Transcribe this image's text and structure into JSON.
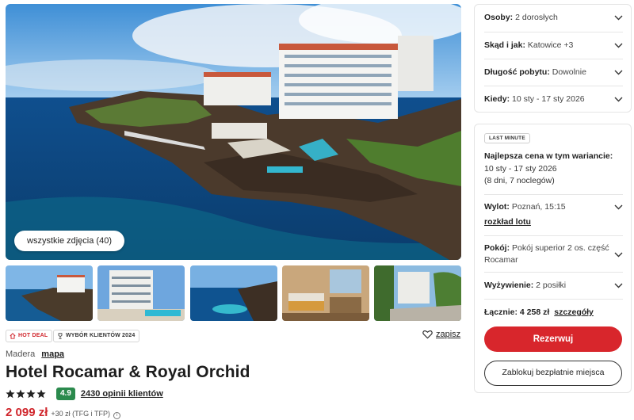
{
  "gallery": {
    "all_photos_label": "wszystkie zdjęcia (40)"
  },
  "badges": {
    "hot_deal": "HOT DEAL",
    "award": "WYBÓR KLIENTÓW 2024"
  },
  "save_label": "zapisz",
  "hotel": {
    "region": "Madera",
    "map_link": "mapa",
    "name": "Hotel Rocamar & Royal Orchid",
    "stars": 4,
    "score": "4.9",
    "reviews": "2430 opinii klientów",
    "price": "2 099 zł",
    "price_extra": "+30 zł (TFG i TFP)"
  },
  "search": {
    "persons_label": "Osoby:",
    "persons_value": "2 dorosłych",
    "from_label": "Skąd i jak:",
    "from_value": "Katowice +3",
    "length_label": "Długość pobytu:",
    "length_value": "Dowolnie",
    "when_label": "Kiedy:",
    "when_value": "10 sty - 17 sty 2026"
  },
  "offer": {
    "badge": "LAST MINUTE",
    "best_title": "Najlepsza cena w tym wariancie:",
    "best_dates": "10 sty - 17 sty 2026",
    "best_nights": "(8 dni, 7 noclegów)",
    "departure_label": "Wylot:",
    "departure_value": "Poznań, 15:15",
    "flight_link": "rozkład lotu",
    "room_label": "Pokój:",
    "room_value_1": "Pokój superior 2 os. część",
    "room_value_2": "Rocamar",
    "board_label": "Wyżywienie:",
    "board_value": "2 posiłki",
    "total_label": "Łącznie: 4 258 zł",
    "total_link": "szczegóły",
    "reserve_label": "Rezerwuj",
    "hold_label": "Zablokuj bezpłatnie miejsca"
  },
  "colors": {
    "accent_red": "#d8262c",
    "score_green": "#2b8a4d"
  }
}
